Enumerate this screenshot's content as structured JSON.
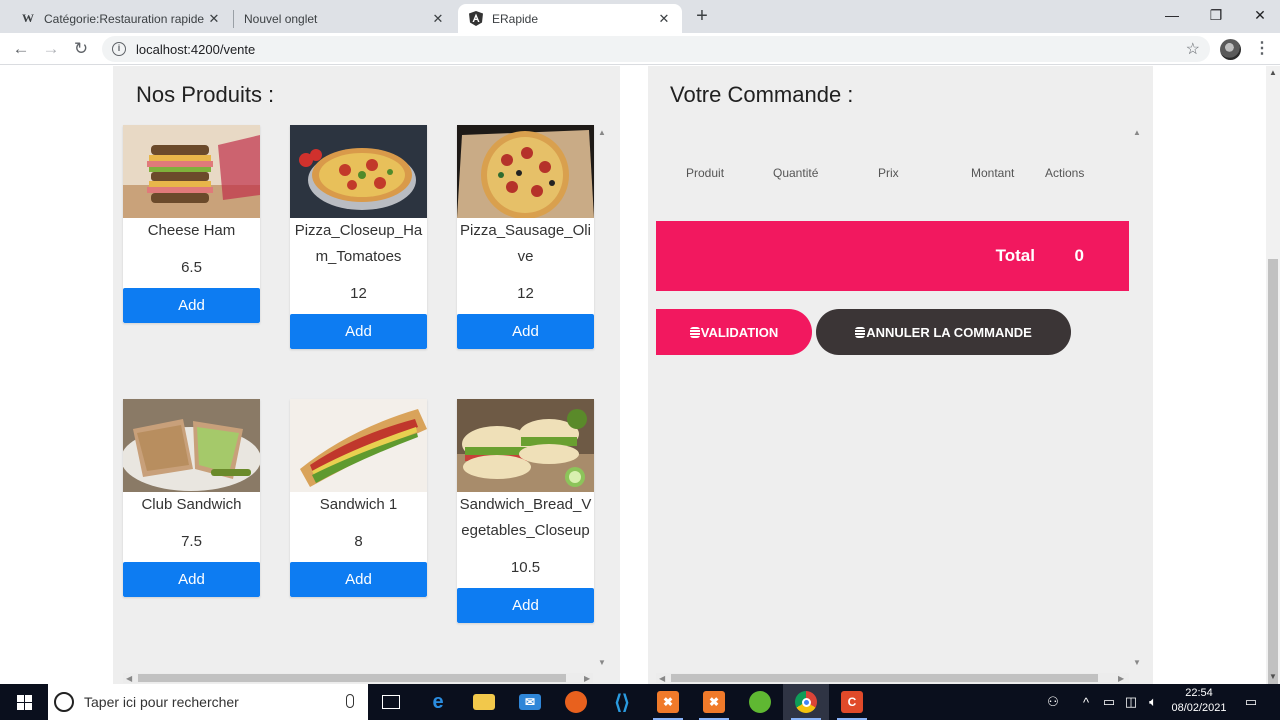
{
  "browser": {
    "tabs": [
      {
        "title": "Catégorie:Restauration rapide —",
        "favicon": "W"
      },
      {
        "title": "Nouvel onglet",
        "favicon": ""
      },
      {
        "title": "ERapide",
        "favicon": "A"
      }
    ],
    "url": "localhost:4200/vente"
  },
  "products": {
    "title": "Nos Produits :",
    "add_label": "Add",
    "items": [
      {
        "name": "Cheese Ham",
        "price": "6.5",
        "image": "sandwich-photo"
      },
      {
        "name": "Pizza_Closeup_Ham_Tomatoes",
        "price": "12",
        "image": "pizza-photo"
      },
      {
        "name": "Pizza_Sausage_Olive",
        "price": "12",
        "image": "pizza-box-photo"
      },
      {
        "name": "Club Sandwich",
        "price": "7.5",
        "image": "club-sandwich-photo"
      },
      {
        "name": "Sandwich 1",
        "price": "8",
        "image": "baguette-photo"
      },
      {
        "name": "Sandwich_Bread_Vegetables_Closeup",
        "price": "10.5",
        "image": "sub-sandwich-photo"
      }
    ]
  },
  "order": {
    "title": "Votre Commande :",
    "columns": [
      "Produit",
      "Quantité",
      "Prix",
      "Montant",
      "Actions"
    ],
    "total_label": "Total",
    "total_value": "0",
    "validate_label": "VALIDATION",
    "cancel_label": "ANNULER LA COMMANDE"
  },
  "taskbar": {
    "search_placeholder": "Taper ici pour rechercher",
    "time": "22:54",
    "date": "08/02/2021"
  },
  "colors": {
    "accent_pink": "#f2185f",
    "add_blue": "#0d7cf2",
    "cancel_dark": "#3b3536"
  }
}
